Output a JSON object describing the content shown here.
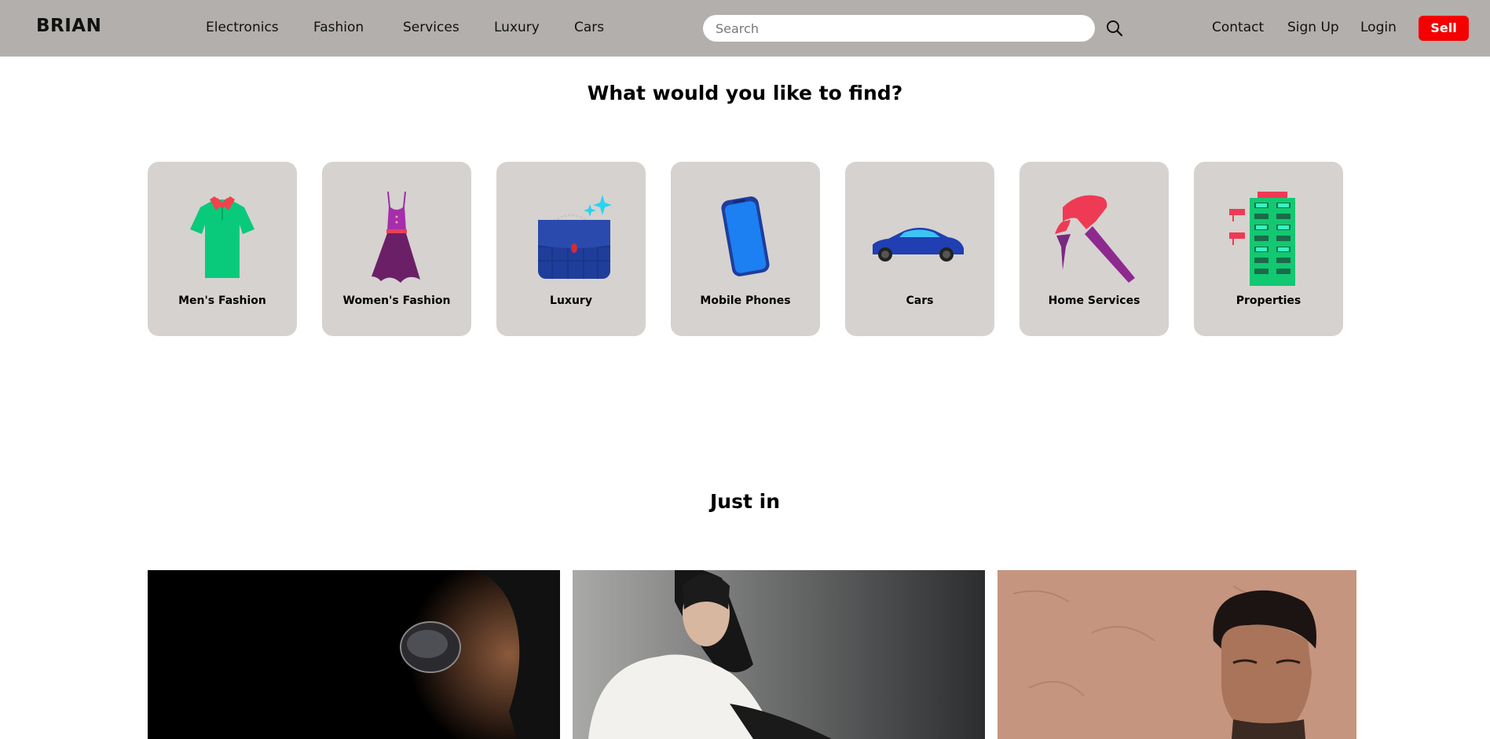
{
  "brand": "BRIAN",
  "nav": {
    "links": [
      "Electronics",
      "Fashion",
      "Services",
      "Luxury",
      "Cars"
    ],
    "search_placeholder": "Search",
    "search_icon": "search-icon",
    "contact": "Contact",
    "signup": "Sign Up",
    "login": "Login",
    "sell": "Sell"
  },
  "find_section": {
    "title": "What would you like to find?",
    "categories": [
      {
        "label": "Men's Fashion",
        "icon": "tshirt-icon"
      },
      {
        "label": "Women's Fashion",
        "icon": "dress-icon"
      },
      {
        "label": "Luxury",
        "icon": "handbag-icon"
      },
      {
        "label": "Mobile Phones",
        "icon": "phone-icon"
      },
      {
        "label": "Cars",
        "icon": "car-icon"
      },
      {
        "label": "Home Services",
        "icon": "hammer-icon"
      },
      {
        "label": "Properties",
        "icon": "building-icon"
      }
    ]
  },
  "just_in": {
    "title": "Just in",
    "photos": [
      "woman-sunglasses-photo",
      "woman-white-tshirt-photo",
      "man-portrait-photo"
    ]
  },
  "colors": {
    "navbar_bg": "#b2afac",
    "card_bg": "#d6d2cf",
    "sell_bg": "#f40000"
  }
}
